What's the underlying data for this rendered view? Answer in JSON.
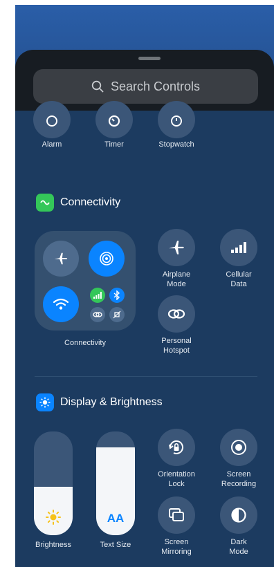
{
  "search": {
    "label": "Search Controls",
    "icon": "search-icon"
  },
  "clock_controls": [
    {
      "label": "Alarm",
      "icon": "alarm-icon"
    },
    {
      "label": "Timer",
      "icon": "timer-icon"
    },
    {
      "label": "Stopwatch",
      "icon": "stopwatch-icon"
    }
  ],
  "connectivity": {
    "title": "Connectivity",
    "badge_color": "#34c759",
    "group_label": "Connectivity",
    "group_tiles": [
      {
        "name": "Airplane Mode",
        "icon": "airplane-icon",
        "on": false
      },
      {
        "name": "AirDrop",
        "icon": "airdrop-icon",
        "on": true
      },
      {
        "name": "Wi-Fi",
        "icon": "wifi-icon",
        "on": true
      },
      {
        "name": "Cellular Data",
        "icon": "cellular-icon",
        "on": true
      },
      {
        "name": "Bluetooth",
        "icon": "bluetooth-icon",
        "on": true
      },
      {
        "name": "Personal Hotspot",
        "icon": "link-icon",
        "on": false
      },
      {
        "name": "Satellite",
        "icon": "satellite-icon",
        "on": false
      }
    ],
    "controls": [
      {
        "label_line1": "Airplane",
        "label_line2": "Mode",
        "icon": "airplane-icon"
      },
      {
        "label_line1": "Cellular",
        "label_line2": "Data",
        "icon": "cellular-bars-icon"
      },
      {
        "label_line1": "Personal",
        "label_line2": "Hotspot",
        "icon": "link-icon"
      }
    ]
  },
  "display": {
    "title": "Display & Brightness",
    "badge_color": "#0a84ff",
    "brightness": {
      "label": "Brightness",
      "level": 0.47,
      "icon": "sun-icon"
    },
    "text_size": {
      "label": "Text Size",
      "level": 0.85,
      "glyph": "AA"
    },
    "controls": [
      {
        "label_line1": "Orientation",
        "label_line2": "Lock",
        "icon": "rotation-lock-icon"
      },
      {
        "label_line1": "Screen",
        "label_line2": "Recording",
        "icon": "record-icon"
      },
      {
        "label_line1": "Screen",
        "label_line2": "Mirroring",
        "icon": "mirroring-icon"
      },
      {
        "label_line1": "Dark",
        "label_line2": "Mode",
        "icon": "dark-mode-icon"
      }
    ]
  },
  "colors": {
    "accent_blue": "#0a84ff",
    "accent_green": "#34c759",
    "sheet": "#1c3b60",
    "tile": "#3b5678"
  }
}
